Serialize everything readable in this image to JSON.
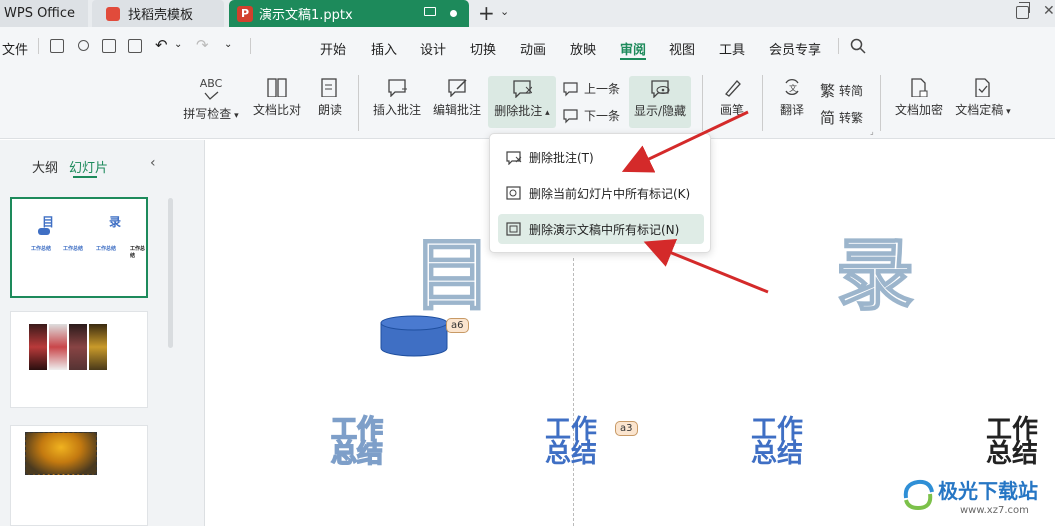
{
  "titlebar": {
    "app_name": "WPS Office",
    "tab_template": "找稻壳模板",
    "tab_document": "演示文稿1.pptx",
    "ppt_badge": "P"
  },
  "menubar": {
    "file": "文件",
    "items": [
      "开始",
      "插入",
      "设计",
      "切换",
      "动画",
      "放映",
      "审阅",
      "视图",
      "工具",
      "会员专享"
    ],
    "active": "审阅"
  },
  "ribbon": {
    "spellcheck": "拼写检查",
    "compare": "文档比对",
    "read_aloud": "朗读",
    "insert_comment": "插入批注",
    "edit_comment": "编辑批注",
    "delete_comment": "删除批注",
    "prev": "上一条",
    "next": "下一条",
    "show_hide": "显示/隐藏",
    "pen": "画笔",
    "translate": "翻译",
    "to_simplified": "转简",
    "to_traditional": "转繁",
    "encrypt": "文档加密",
    "finalize": "文档定稿",
    "abc_label": "ABC"
  },
  "dropdown": {
    "items": [
      "删除批注(T)",
      "删除当前幻灯片中所有标记(K)",
      "删除演示文稿中所有标记(N)"
    ]
  },
  "leftpanel": {
    "tab_outline": "大纲",
    "tab_slides": "幻灯片",
    "thumb1_title_left": "目",
    "thumb1_title_right": "录",
    "thumb1_small": "工作总结"
  },
  "slide": {
    "char_left": "目",
    "char_right": "录",
    "work_line1": "工作",
    "work_line2": "总结",
    "badge_a6": "a6",
    "badge_a3": "a3"
  },
  "watermark": {
    "text": "极光下载站",
    "url": "www.xz7.com"
  },
  "colors": {
    "accent": "#1d8a5b",
    "arrow": "#d42a2a",
    "cylinder": "#3f6fc4"
  }
}
